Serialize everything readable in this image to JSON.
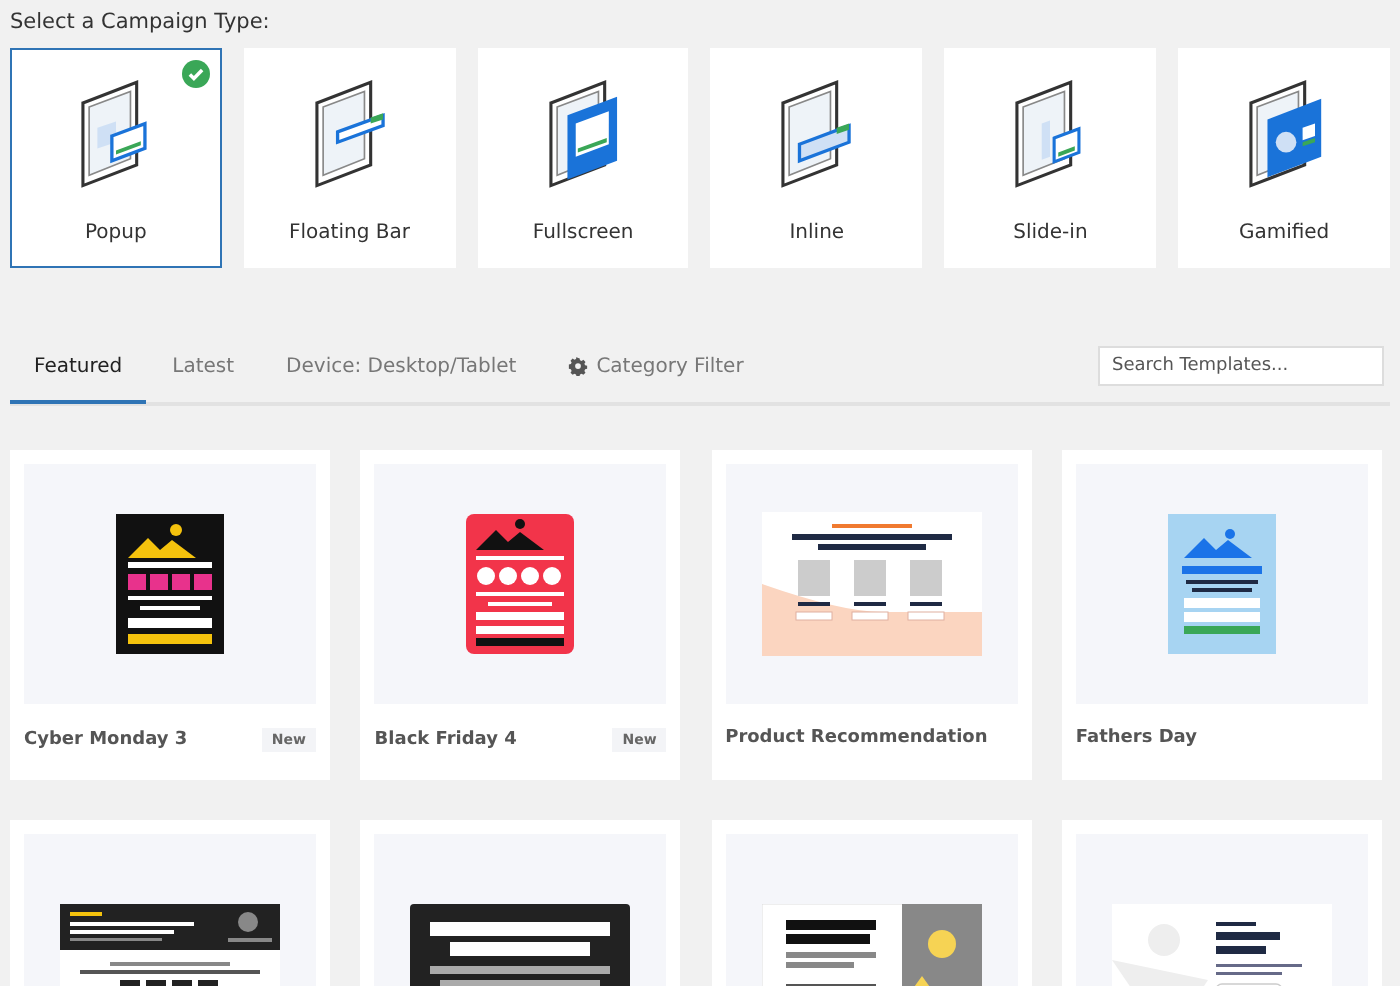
{
  "heading": "Select a Campaign Type:",
  "campaign_types": [
    {
      "label": "Popup",
      "kind": "popup",
      "selected": true
    },
    {
      "label": "Floating Bar",
      "kind": "floating",
      "selected": false
    },
    {
      "label": "Fullscreen",
      "kind": "fullscreen",
      "selected": false
    },
    {
      "label": "Inline",
      "kind": "inline",
      "selected": false
    },
    {
      "label": "Slide-in",
      "kind": "slidein",
      "selected": false
    },
    {
      "label": "Gamified",
      "kind": "gamified",
      "selected": false
    }
  ],
  "tabs": [
    {
      "label": "Featured",
      "selected": true,
      "kind": "tab"
    },
    {
      "label": "Latest",
      "selected": false,
      "kind": "tab"
    },
    {
      "label": "Device: Desktop/Tablet",
      "selected": false,
      "kind": "tab"
    },
    {
      "label": "Category Filter",
      "selected": false,
      "kind": "settings"
    }
  ],
  "search": {
    "placeholder": "Search Templates..."
  },
  "templates": [
    {
      "title": "Cyber Monday 3",
      "badge": "New",
      "kind": "cyber"
    },
    {
      "title": "Black Friday 4",
      "badge": "New",
      "kind": "blackfriday"
    },
    {
      "title": "Product Recommendation",
      "kind": "product"
    },
    {
      "title": "Fathers Day",
      "kind": "fathers"
    },
    {
      "kind": "darkheader"
    },
    {
      "kind": "darkbanner"
    },
    {
      "kind": "split"
    },
    {
      "kind": "lightsplit"
    }
  ]
}
